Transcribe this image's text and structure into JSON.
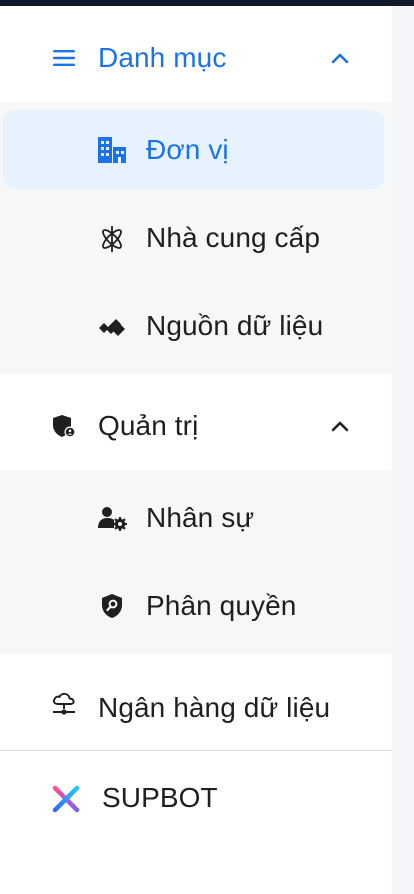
{
  "menu": {
    "catalog": {
      "label": "Danh mục",
      "icon": "menu-icon",
      "expanded": true,
      "items": [
        {
          "label": "Đơn vị",
          "icon": "building-icon",
          "selected": true
        },
        {
          "label": "Nhà cung cấp",
          "icon": "atom-icon",
          "selected": false
        },
        {
          "label": "Nguồn dữ liệu",
          "icon": "data-source-icon",
          "selected": false
        }
      ]
    },
    "admin": {
      "label": "Quản trị",
      "icon": "shield-user-icon",
      "expanded": true,
      "items": [
        {
          "label": "Nhân sự",
          "icon": "user-gear-icon"
        },
        {
          "label": "Phân quyền",
          "icon": "shield-key-icon"
        }
      ]
    },
    "data_bank": {
      "label": "Ngân hàng dữ liệu",
      "icon": "cloud-network-icon"
    },
    "supbot": {
      "label": "SUPBOT",
      "icon": "supbot-logo-icon"
    }
  },
  "colors": {
    "accent": "#1a73e8",
    "selected_bg": "#e6f3ff",
    "group_bg": "#f7f7f7"
  }
}
